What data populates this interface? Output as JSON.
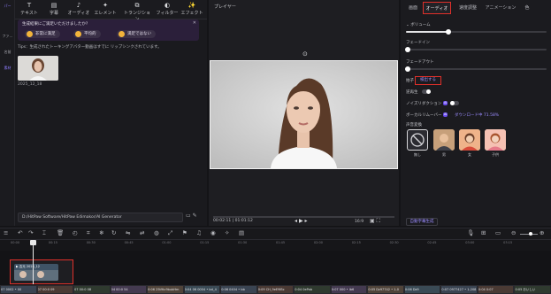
{
  "left_strip": {
    "top_label": "パー",
    "items": [
      "ファ…",
      "名前",
      "素材"
    ]
  },
  "toolbar": {
    "tabs": [
      {
        "label": "テキスト",
        "icon": "T"
      },
      {
        "label": "字幕",
        "icon": "▤"
      },
      {
        "label": "オーディオ",
        "icon": "♪"
      },
      {
        "label": "エレメント",
        "icon": "✦"
      },
      {
        "label": "トランジション",
        "icon": "⧉"
      },
      {
        "label": "フィルター",
        "icon": "◐"
      },
      {
        "label": "エフェクト",
        "icon": "✨"
      }
    ]
  },
  "survey": {
    "question": "生成結果にご満足いただけましたか?",
    "options": [
      "非常に満足",
      "平均的",
      "満足ではない"
    ],
    "close": "✕"
  },
  "tips": "Tips：生成されたトーキングアバター動画はすでに リップシンクされています。",
  "media": {
    "date": "2025_12_18"
  },
  "path": "D:/HitPaw Software/HitPaw Edimakor/AI Generator",
  "preview": {
    "title": "プレイヤー",
    "current_time": "00:02:11",
    "total_time": "01:01:12",
    "aspect": "16:9"
  },
  "right_panel": {
    "tabs": [
      "画面",
      "オーディオ",
      "速度調整",
      "アニメーション",
      "色"
    ],
    "active_tab": "オーディオ",
    "volume_label": "ボリューム",
    "volume_level": 0.3,
    "fade_in_label": "フェードイン",
    "fade_out_label": "フェードアウト",
    "beat_label": "拍子",
    "detect_label": "検出する",
    "reverse_label": "逆再生",
    "noise_label": "ノイズリダクション",
    "vocal_label": "ボーカルリムーバー",
    "vocal_extra": "ダウンロード中 71.58%",
    "ai_badge": "AI",
    "voice_label": "声音変換",
    "voices": [
      "無し",
      "男",
      "女",
      "子供"
    ],
    "auto_caption": "自動字幕生成"
  },
  "timeline": {
    "ruler": [
      "00:00",
      "00:15",
      "00:30",
      "00:45",
      "01:00",
      "01:15",
      "01:30",
      "01:45",
      "02:00",
      "02:15",
      "02:30",
      "02:45",
      "03:00",
      "03:15",
      "03:30",
      "03:45",
      "04:00",
      "04:15",
      "04:30",
      "04:45",
      "05:00"
    ],
    "clip_label": "▶ 吉元 2025_12",
    "strip": [
      "07 0002 • 00",
      "07 00:0 09",
      "07 00:0 08",
      "04 00:0 54",
      "0:06 25t9tc9bubHm",
      "0:04 06 0004 • bd_4",
      "0:06 0404 • bb",
      "0:09 CH_9eE9lBc",
      "0:04 0ePab",
      "0:07 000 • Ib6",
      "0:05 Dz97742 • 1-0",
      "0:06 Dz9",
      "0:07 0977427 • 1-208",
      "0:04 0:07",
      "0:05 おいしい"
    ]
  },
  "colors": {
    "accent": "#6a4df0",
    "highlight": "#e0302a",
    "panel": "#1b1b1f"
  }
}
